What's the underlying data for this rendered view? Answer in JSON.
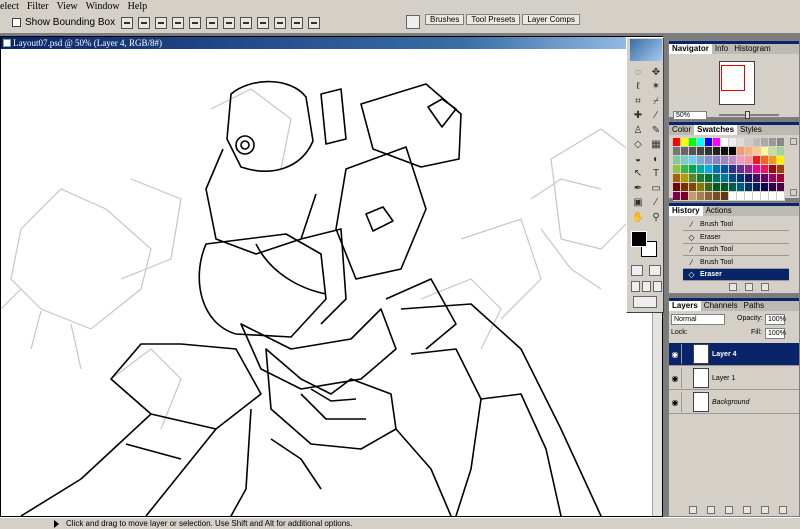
{
  "menu": [
    "elect",
    "Filter",
    "View",
    "Window",
    "Help"
  ],
  "options": {
    "checkbox_label": "Show Bounding Box",
    "show_bounding_box": false
  },
  "dock_tabs": [
    "Brushes",
    "Tool Presets",
    "Layer Comps"
  ],
  "document": {
    "title": "Layout07.psd @ 50% (Layer 4, RGB/8#)"
  },
  "status": {
    "text": "Click and drag to move layer or selection. Use Shift and Alt for additional options."
  },
  "toolbox": {
    "tools": [
      "marquee-icon",
      "move-icon",
      "lasso-icon",
      "magic-wand-icon",
      "crop-icon",
      "slice-icon",
      "healing-brush-icon",
      "brush-icon",
      "clone-stamp-icon",
      "history-brush-icon",
      "eraser-icon",
      "gradient-icon",
      "blur-icon",
      "dodge-icon",
      "path-selection-icon",
      "type-icon",
      "pen-icon",
      "shape-icon",
      "notes-icon",
      "eyedropper-icon",
      "hand-icon",
      "zoom-icon"
    ],
    "glyphs": [
      "◌",
      "✥",
      "ℓ",
      "✶",
      "⌗",
      "⌿",
      "✚",
      "∕",
      "♙",
      "✎",
      "◇",
      "▦",
      "◒",
      "◐",
      "↖",
      "T",
      "✒",
      "▭",
      "▣",
      "⁄",
      "✋",
      "⚲"
    ],
    "foreground_color": "#000000",
    "background_color": "#ffffff"
  },
  "navigator": {
    "tabs": [
      "Navigator",
      "Info",
      "Histogram"
    ],
    "zoom": "50%"
  },
  "swatches": {
    "tabs": [
      "Color",
      "Swatches",
      "Styles"
    ],
    "colors": [
      "#ff0000",
      "#ffff00",
      "#00ff00",
      "#00ffff",
      "#0000ff",
      "#ff00ff",
      "#ffffff",
      "#eeeeee",
      "#dddddd",
      "#cccccc",
      "#bbbbbb",
      "#aaaaaa",
      "#999999",
      "#888888",
      "#777777",
      "#666666",
      "#555555",
      "#444444",
      "#333333",
      "#222222",
      "#111111",
      "#000000",
      "#f7977a",
      "#f9ad81",
      "#fdc68a",
      "#fff79a",
      "#c4df9b",
      "#a3d39c",
      "#82ca9d",
      "#7bcdc8",
      "#6ecff6",
      "#7ea7d8",
      "#8493ca",
      "#8882be",
      "#a187be",
      "#bc8dbf",
      "#f49ac2",
      "#f6989d",
      "#ed1c24",
      "#f26522",
      "#f7941d",
      "#fff200",
      "#8dc63f",
      "#39b54a",
      "#00a651",
      "#00a99d",
      "#00aeef",
      "#0072bc",
      "#0054a6",
      "#2e3192",
      "#662d91",
      "#92278f",
      "#ec008c",
      "#ed145b",
      "#9e0b0f",
      "#a0410d",
      "#a36209",
      "#aba000",
      "#598527",
      "#1a7b30",
      "#007236",
      "#00746b",
      "#0076a3",
      "#004b80",
      "#003471",
      "#1b1464",
      "#440e62",
      "#630460",
      "#9e005d",
      "#9e0039",
      "#790000",
      "#7b2e00",
      "#7d4900",
      "#827b00",
      "#406618",
      "#005e20",
      "#005826",
      "#005952",
      "#005b7f",
      "#003663",
      "#002157",
      "#0d004c",
      "#32004b",
      "#4b0049",
      "#7b0046",
      "#7a0026",
      "#c69c6d",
      "#a67c52",
      "#8c6239",
      "#754c24",
      "#603913",
      "#ffffff",
      "#ffffff",
      "#ffffff",
      "#ffffff",
      "#ffffff",
      "#ffffff",
      "#ffffff"
    ]
  },
  "history": {
    "tabs": [
      "History",
      "Actions"
    ],
    "items": [
      {
        "label": "Brush Tool",
        "icon": "brush-icon",
        "glyph": "∕"
      },
      {
        "label": "Eraser",
        "icon": "eraser-icon",
        "glyph": "◇"
      },
      {
        "label": "Brush Tool",
        "icon": "brush-icon",
        "glyph": "∕"
      },
      {
        "label": "Brush Tool",
        "icon": "brush-icon",
        "glyph": "∕"
      },
      {
        "label": "Eraser",
        "icon": "eraser-icon",
        "glyph": "◇"
      }
    ],
    "selected_index": 4
  },
  "layers": {
    "tabs": [
      "Layers",
      "Channels",
      "Paths"
    ],
    "blend_mode": "Normal",
    "opacity_label": "Opacity:",
    "opacity": "100%",
    "lock_label": "Lock:",
    "fill_label": "Fill:",
    "fill": "100%",
    "items": [
      {
        "name": "Layer 4",
        "visible": true
      },
      {
        "name": "Layer 1",
        "visible": true
      },
      {
        "name": "Background",
        "visible": true
      }
    ],
    "selected_index": 0
  }
}
